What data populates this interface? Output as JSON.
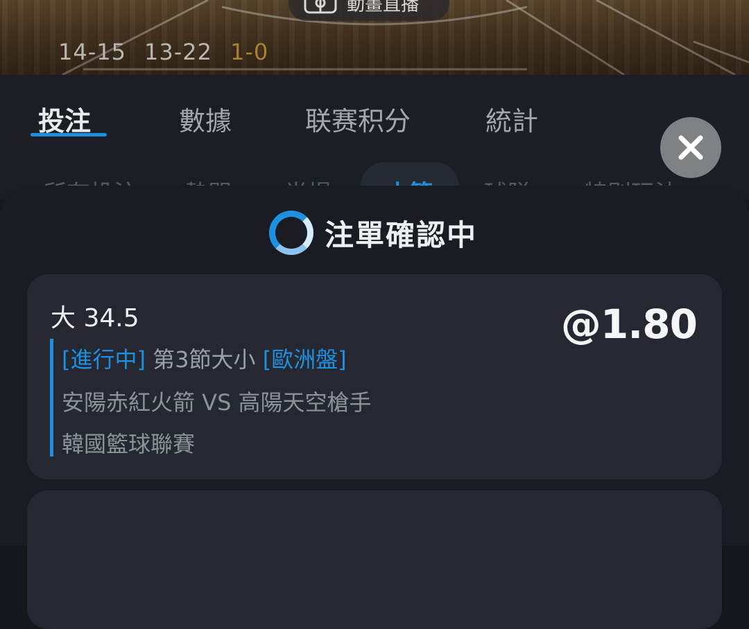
{
  "hero": {
    "live_label": "動畫直播",
    "scores": [
      "14-15",
      "13-22",
      "1-0"
    ]
  },
  "tabs": [
    {
      "label": "投注",
      "active": true
    },
    {
      "label": "數據",
      "active": false
    },
    {
      "label": "联赛积分",
      "active": false
    },
    {
      "label": "統計",
      "active": false
    }
  ],
  "subtabs": [
    {
      "label": "所有投注"
    },
    {
      "label": "熱門"
    },
    {
      "label": "半場"
    },
    {
      "label": "小節",
      "active": true
    },
    {
      "label": "球隊"
    },
    {
      "label": "特別玩法"
    }
  ],
  "sheet": {
    "status": "注單確認中",
    "bet": {
      "selection": "大 34.5",
      "odds": "@1.80",
      "state_tag": "[進行中]",
      "market": "第3節大小",
      "odds_type_tag": "[歐洲盤]",
      "match": "安陽赤紅火箭 VS 高陽天空槍手",
      "league": "韓國籃球聯賽"
    }
  },
  "colors": {
    "accent": "#1f8fe0",
    "background": "#15171d",
    "card": "#262831"
  }
}
